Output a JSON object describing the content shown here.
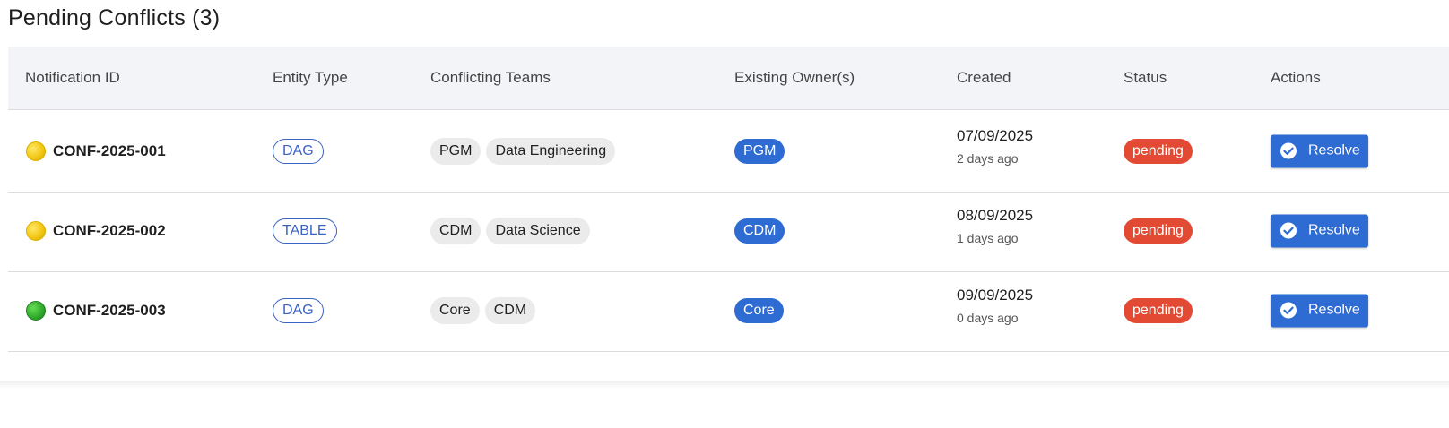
{
  "page": {
    "title": "Pending Conflicts (3)"
  },
  "table": {
    "headers": [
      "Notification ID",
      "Entity Type",
      "Conflicting Teams",
      "Existing Owner(s)",
      "Created",
      "Status",
      "Actions"
    ],
    "rows": [
      {
        "indicator_color": "yellow",
        "notification_id": "CONF-2025-001",
        "entity_type": "DAG",
        "conflicting_teams": [
          "PGM",
          "Data Engineering"
        ],
        "existing_owner": "PGM",
        "created_date": "07/09/2025",
        "created_ago": "2 days ago",
        "status": "pending",
        "action_label": "Resolve"
      },
      {
        "indicator_color": "yellow",
        "notification_id": "CONF-2025-002",
        "entity_type": "TABLE",
        "conflicting_teams": [
          "CDM",
          "Data Science"
        ],
        "existing_owner": "CDM",
        "created_date": "08/09/2025",
        "created_ago": "1 days ago",
        "status": "pending",
        "action_label": "Resolve"
      },
      {
        "indicator_color": "green",
        "notification_id": "CONF-2025-003",
        "entity_type": "DAG",
        "conflicting_teams": [
          "Core",
          "CDM"
        ],
        "existing_owner": "Core",
        "created_date": "09/09/2025",
        "created_ago": "0 days ago",
        "status": "pending",
        "action_label": "Resolve"
      }
    ]
  },
  "colors": {
    "primary": "#2e6bd2",
    "status_pending": "#e24a33",
    "header_bg": "#f3f4f8",
    "chip_bg": "#ebebeb"
  },
  "icons": {
    "resolve": "check-circle-icon",
    "indicator": "status-dot-icon"
  }
}
